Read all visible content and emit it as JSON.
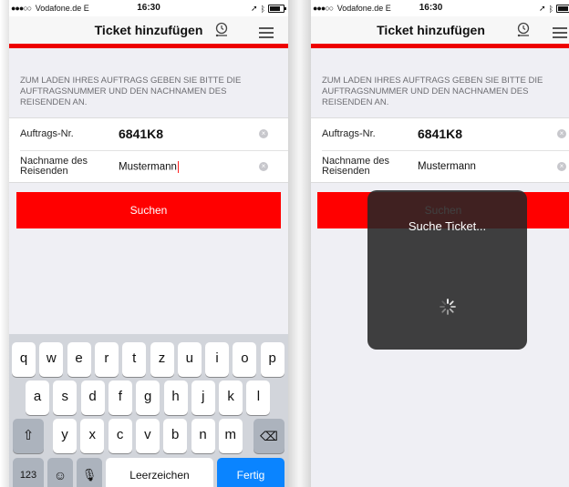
{
  "status_bar": {
    "carrier": "Vodafone.de",
    "network": "E",
    "time": "16:30"
  },
  "screen": {
    "title": "Ticket hinzufügen",
    "instructions": "ZUM LADEN IHRES AUFTRAGS GEBEN SIE BITTE DIE AUFTRAGSNUMMER UND DEN NACHNAMEN DES REISENDEN AN.",
    "order_label": "Auftrags-Nr.",
    "order_value": "6841K8",
    "name_label": "Nachname des Reisenden",
    "name_value": "Mustermann",
    "search_button": "Suchen"
  },
  "loading_hud": {
    "text": "Suche Ticket..."
  },
  "keyboard": {
    "row1": [
      "q",
      "w",
      "e",
      "r",
      "t",
      "z",
      "u",
      "i",
      "o",
      "p"
    ],
    "row2": [
      "a",
      "s",
      "d",
      "f",
      "g",
      "h",
      "j",
      "k",
      "l"
    ],
    "row3": [
      "y",
      "x",
      "c",
      "v",
      "b",
      "n",
      "m"
    ],
    "numbers_key": "123",
    "space_key": "Leerzeichen",
    "done_key": "Fertig"
  },
  "colors": {
    "accent_red": "#ee0000",
    "button_red": "#ff0000",
    "keyboard_blue": "#0a84ff"
  },
  "icons": [
    "ticket-clock-icon",
    "hamburger-menu-icon",
    "clear-input-icon",
    "shift-icon",
    "backspace-icon",
    "emoji-icon",
    "microphone-icon",
    "spinner-icon"
  ]
}
